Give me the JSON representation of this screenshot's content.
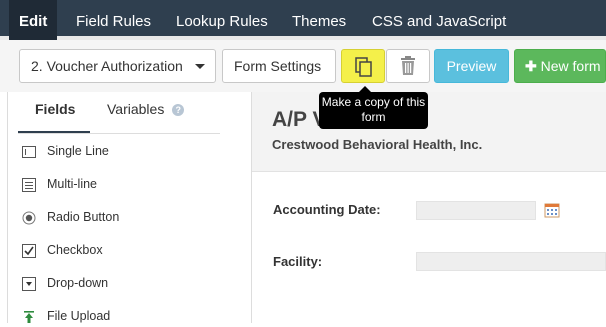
{
  "topnav": {
    "tabs": [
      {
        "label": "Edit",
        "active": true
      },
      {
        "label": "Field Rules"
      },
      {
        "label": "Lookup Rules"
      },
      {
        "label": "Themes"
      },
      {
        "label": "CSS and JavaScript"
      }
    ]
  },
  "toolbar": {
    "form_select": "2. Voucher Authorization",
    "form_settings_label": "Form Settings",
    "copy_icon": "copy-icon",
    "trash_icon": "trash-icon",
    "preview_label": "Preview",
    "new_form_label": "New form",
    "new_form_icon": "plus-icon"
  },
  "tooltip": {
    "text": "Make a copy of this form"
  },
  "sidebar": {
    "tabs": [
      {
        "label": "Fields",
        "active": true
      },
      {
        "label": "Variables"
      }
    ],
    "help_icon": "?",
    "fields": [
      {
        "label": "Single Line",
        "icon": "single-line-icon"
      },
      {
        "label": "Multi-line",
        "icon": "multi-line-icon"
      },
      {
        "label": "Radio Button",
        "icon": "radio-icon"
      },
      {
        "label": "Checkbox",
        "icon": "checkbox-icon"
      },
      {
        "label": "Drop-down",
        "icon": "dropdown-icon"
      },
      {
        "label": "File Upload",
        "icon": "upload-icon"
      }
    ]
  },
  "form": {
    "title": "A/P VOUCHER",
    "organization": "Crestwood Behavioral Health, Inc.",
    "fields": [
      {
        "label": "Accounting Date:"
      },
      {
        "label": "Facility:"
      }
    ]
  },
  "colors": {
    "nav_bg": "#2f3f4f",
    "highlight": "#f4f04a",
    "preview": "#5bc0de",
    "new_form": "#5cb85c"
  }
}
